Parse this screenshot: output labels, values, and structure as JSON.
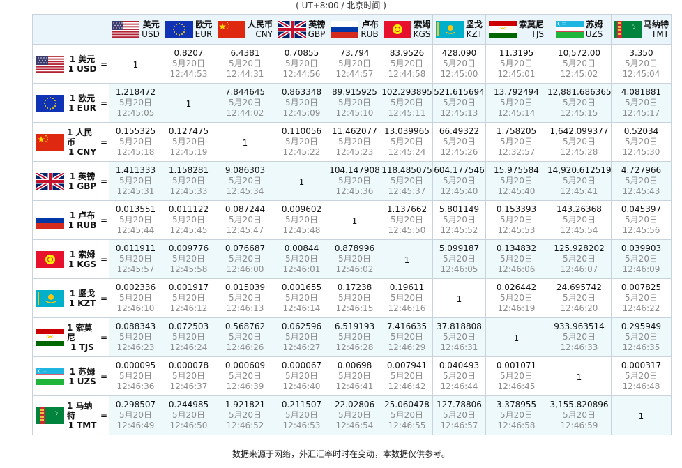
{
  "header": {
    "timezone": "( UT+8:00 / 北京时间 )"
  },
  "columns": [
    {
      "name": "美元",
      "code": "USD",
      "flag": "us-flag"
    },
    {
      "name": "欧元",
      "code": "EUR",
      "flag": "eu-flag"
    },
    {
      "name": "人民币",
      "code": "CNY",
      "flag": "cn-flag"
    },
    {
      "name": "英镑",
      "code": "GBP",
      "flag": "gb-flag"
    },
    {
      "name": "卢布",
      "code": "RUB",
      "flag": "ru-flag"
    },
    {
      "name": "索姆",
      "code": "KGS",
      "flag": "kg-flag"
    },
    {
      "name": "坚戈",
      "code": "KZT",
      "flag": "kz-flag"
    },
    {
      "name": "索莫尼",
      "code": "TJS",
      "flag": "tj-flag"
    },
    {
      "name": "苏姆",
      "code": "UZS",
      "flag": "uz-flag"
    },
    {
      "name": "马纳特",
      "code": "TMT",
      "flag": "tm-flag"
    }
  ],
  "rows": [
    {
      "label": "1 美元",
      "code": "1 USD",
      "flag": "us-flag",
      "cells": [
        {
          "value": "1"
        },
        {
          "value": "0.8207",
          "date": "5月20日",
          "time": "12:44:53"
        },
        {
          "value": "6.4381",
          "date": "5月20日",
          "time": "12:44:31"
        },
        {
          "value": "0.70855",
          "date": "5月20日",
          "time": "12:44:56"
        },
        {
          "value": "73.794",
          "date": "5月20日",
          "time": "12:44:57"
        },
        {
          "value": "83.9526",
          "date": "5月20日",
          "time": "12:44:58"
        },
        {
          "value": "428.090",
          "date": "5月20日",
          "time": "12:45:00"
        },
        {
          "value": "11.3195",
          "date": "5月20日",
          "time": "12:45:01"
        },
        {
          "value": "10,572.00",
          "date": "5月20日",
          "time": "12:45:02"
        },
        {
          "value": "3.350",
          "date": "5月20日",
          "time": "12:45:04"
        }
      ]
    },
    {
      "label": "1 欧元",
      "code": "1 EUR",
      "flag": "eu-flag",
      "cells": [
        {
          "value": "1.218472",
          "date": "5月20日",
          "time": "12:45:05"
        },
        {
          "value": "1"
        },
        {
          "value": "7.844645",
          "date": "5月20日",
          "time": "12:44:02"
        },
        {
          "value": "0.863348",
          "date": "5月20日",
          "time": "12:45:09"
        },
        {
          "value": "89.915925",
          "date": "5月20日",
          "time": "12:45:10"
        },
        {
          "value": "102.293895",
          "date": "5月20日",
          "time": "12:45:11"
        },
        {
          "value": "521.615694",
          "date": "5月20日",
          "time": "12:45:13"
        },
        {
          "value": "13.792494",
          "date": "5月20日",
          "time": "12:45:14"
        },
        {
          "value": "12,881.686365",
          "date": "5月20日",
          "time": "12:45:15"
        },
        {
          "value": "4.081881",
          "date": "5月20日",
          "time": "12:45:17"
        }
      ]
    },
    {
      "label": "1 人民币",
      "code": "1 CNY",
      "flag": "cn-flag",
      "cells": [
        {
          "value": "0.155325",
          "date": "5月20日",
          "time": "12:45:18"
        },
        {
          "value": "0.127475",
          "date": "5月20日",
          "time": "12:45:19"
        },
        {
          "value": "1"
        },
        {
          "value": "0.110056",
          "date": "5月20日",
          "time": "12:45:22"
        },
        {
          "value": "11.462077",
          "date": "5月20日",
          "time": "12:45:23"
        },
        {
          "value": "13.039965",
          "date": "5月20日",
          "time": "12:45:24"
        },
        {
          "value": "66.49322",
          "date": "5月20日",
          "time": "12:45:26"
        },
        {
          "value": "1.758205",
          "date": "5月20日",
          "time": "12:32:57"
        },
        {
          "value": "1,642.099377",
          "date": "5月20日",
          "time": "12:45:28"
        },
        {
          "value": "0.52034",
          "date": "5月20日",
          "time": "12:45:30"
        }
      ]
    },
    {
      "label": "1 英镑",
      "code": "1 GBP",
      "flag": "gb-flag",
      "cells": [
        {
          "value": "1.411333",
          "date": "5月20日",
          "time": "12:45:31"
        },
        {
          "value": "1.158281",
          "date": "5月20日",
          "time": "12:45:33"
        },
        {
          "value": "9.086303",
          "date": "5月20日",
          "time": "12:45:34"
        },
        {
          "value": "1"
        },
        {
          "value": "104.147908",
          "date": "5月20日",
          "time": "12:45:36"
        },
        {
          "value": "118.485075",
          "date": "5月20日",
          "time": "12:45:37"
        },
        {
          "value": "604.177546",
          "date": "5月20日",
          "time": "12:45:40"
        },
        {
          "value": "15.975584",
          "date": "5月20日",
          "time": "12:45:40"
        },
        {
          "value": "14,920.612519",
          "date": "5月20日",
          "time": "12:45:41"
        },
        {
          "value": "4.727966",
          "date": "5月20日",
          "time": "12:45:43"
        }
      ]
    },
    {
      "label": "1 卢布",
      "code": "1 RUB",
      "flag": "ru-flag",
      "cells": [
        {
          "value": "0.013551",
          "date": "5月20日",
          "time": "12:45:44"
        },
        {
          "value": "0.011122",
          "date": "5月20日",
          "time": "12:45:45"
        },
        {
          "value": "0.087244",
          "date": "5月20日",
          "time": "12:45:47"
        },
        {
          "value": "0.009602",
          "date": "5月20日",
          "time": "12:45:48"
        },
        {
          "value": "1"
        },
        {
          "value": "1.137662",
          "date": "5月20日",
          "time": "12:45:50"
        },
        {
          "value": "5.801149",
          "date": "5月20日",
          "time": "12:45:52"
        },
        {
          "value": "0.153393",
          "date": "5月20日",
          "time": "12:45:53"
        },
        {
          "value": "143.26368",
          "date": "5月20日",
          "time": "12:45:54"
        },
        {
          "value": "0.045397",
          "date": "5月20日",
          "time": "12:45:56"
        }
      ]
    },
    {
      "label": "1 索姆",
      "code": "1 KGS",
      "flag": "kg-flag",
      "cells": [
        {
          "value": "0.011911",
          "date": "5月20日",
          "time": "12:45:57"
        },
        {
          "value": "0.009776",
          "date": "5月20日",
          "time": "12:45:58"
        },
        {
          "value": "0.076687",
          "date": "5月20日",
          "time": "12:46:00"
        },
        {
          "value": "0.00844",
          "date": "5月20日",
          "time": "12:46:01"
        },
        {
          "value": "0.878996",
          "date": "5月20日",
          "time": "12:46:02"
        },
        {
          "value": "1"
        },
        {
          "value": "5.099187",
          "date": "5月20日",
          "time": "12:46:05"
        },
        {
          "value": "0.134832",
          "date": "5月20日",
          "time": "12:46:06"
        },
        {
          "value": "125.928202",
          "date": "5月20日",
          "time": "12:46:07"
        },
        {
          "value": "0.039903",
          "date": "5月20日",
          "time": "12:46:09"
        }
      ]
    },
    {
      "label": "1 坚戈",
      "code": "1 KZT",
      "flag": "kz-flag",
      "cells": [
        {
          "value": "0.002336",
          "date": "5月20日",
          "time": "12:46:10"
        },
        {
          "value": "0.001917",
          "date": "5月20日",
          "time": "12:46:12"
        },
        {
          "value": "0.015039",
          "date": "5月20日",
          "time": "12:46:13"
        },
        {
          "value": "0.001655",
          "date": "5月20日",
          "time": "12:46:14"
        },
        {
          "value": "0.17238",
          "date": "5月20日",
          "time": "12:46:15"
        },
        {
          "value": "0.19611",
          "date": "5月20日",
          "time": "12:46:16"
        },
        {
          "value": "1"
        },
        {
          "value": "0.026442",
          "date": "5月20日",
          "time": "12:46:19"
        },
        {
          "value": "24.695742",
          "date": "5月20日",
          "time": "12:46:20"
        },
        {
          "value": "0.007825",
          "date": "5月20日",
          "time": "12:46:22"
        }
      ]
    },
    {
      "label": "1 索莫尼",
      "code": "1 TJS",
      "flag": "tj-flag",
      "cells": [
        {
          "value": "0.088343",
          "date": "5月20日",
          "time": "12:46:23"
        },
        {
          "value": "0.072503",
          "date": "5月20日",
          "time": "12:46:24"
        },
        {
          "value": "0.568762",
          "date": "5月20日",
          "time": "12:46:26"
        },
        {
          "value": "0.062596",
          "date": "5月20日",
          "time": "12:46:27"
        },
        {
          "value": "6.519193",
          "date": "5月20日",
          "time": "12:46:28"
        },
        {
          "value": "7.416635",
          "date": "5月20日",
          "time": "12:46:29"
        },
        {
          "value": "37.818808",
          "date": "5月20日",
          "time": "12:46:31"
        },
        {
          "value": "1"
        },
        {
          "value": "933.963514",
          "date": "5月20日",
          "time": "12:46:33"
        },
        {
          "value": "0.295949",
          "date": "5月20日",
          "time": "12:46:35"
        }
      ]
    },
    {
      "label": "1 苏姆",
      "code": "1 UZS",
      "flag": "uz-flag",
      "cells": [
        {
          "value": "0.000095",
          "date": "5月20日",
          "time": "12:46:36"
        },
        {
          "value": "0.000078",
          "date": "5月20日",
          "time": "12:46:37"
        },
        {
          "value": "0.000609",
          "date": "5月20日",
          "time": "12:46:39"
        },
        {
          "value": "0.000067",
          "date": "5月20日",
          "time": "12:46:40"
        },
        {
          "value": "0.00698",
          "date": "5月20日",
          "time": "12:46:41"
        },
        {
          "value": "0.007941",
          "date": "5月20日",
          "time": "12:46:42"
        },
        {
          "value": "0.040493",
          "date": "5月20日",
          "time": "12:46:44"
        },
        {
          "value": "0.001071",
          "date": "5月20日",
          "time": "12:46:45"
        },
        {
          "value": "1"
        },
        {
          "value": "0.000317",
          "date": "5月20日",
          "time": "12:46:48"
        }
      ]
    },
    {
      "label": "1 马纳特",
      "code": "1 TMT",
      "flag": "tm-flag",
      "cells": [
        {
          "value": "0.298507",
          "date": "5月20日",
          "time": "12:46:49"
        },
        {
          "value": "0.244985",
          "date": "5月20日",
          "time": "12:46:50"
        },
        {
          "value": "1.921821",
          "date": "5月20日",
          "time": "12:46:52"
        },
        {
          "value": "0.211507",
          "date": "5月20日",
          "time": "12:46:53"
        },
        {
          "value": "22.02806",
          "date": "5月20日",
          "time": "12:46:54"
        },
        {
          "value": "25.060478",
          "date": "5月20日",
          "time": "12:46:55"
        },
        {
          "value": "127.78806",
          "date": "5月20日",
          "time": "12:46:57"
        },
        {
          "value": "3.378955",
          "date": "5月20日",
          "time": "12:46:58"
        },
        {
          "value": "3,155.820896",
          "date": "5月20日",
          "time": "12:46:59"
        },
        {
          "value": "1"
        }
      ]
    }
  ],
  "equals_sign": "=",
  "footer": {
    "note": "数据来源于网络，外汇汇率时时在变动，本数据仅供参考。"
  }
}
